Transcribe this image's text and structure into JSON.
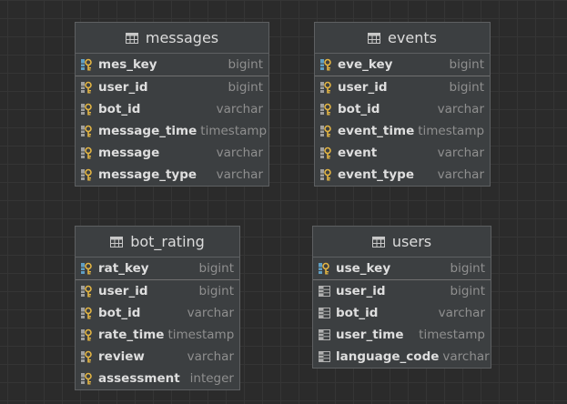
{
  "tables": [
    {
      "id": "messages",
      "title": "messages",
      "columns": [
        {
          "name": "mes_key",
          "type": "bigint",
          "icon": "primary-key-icon"
        },
        {
          "name": "user_id",
          "type": "bigint",
          "icon": "column-key-icon"
        },
        {
          "name": "bot_id",
          "type": "varchar",
          "icon": "column-key-icon"
        },
        {
          "name": "message_time",
          "type": "timestamp",
          "icon": "column-key-icon"
        },
        {
          "name": "message",
          "type": "varchar",
          "icon": "column-key-icon"
        },
        {
          "name": "message_type",
          "type": "varchar",
          "icon": "column-key-icon"
        }
      ]
    },
    {
      "id": "events",
      "title": "events",
      "columns": [
        {
          "name": "eve_key",
          "type": "bigint",
          "icon": "primary-key-icon"
        },
        {
          "name": "user_id",
          "type": "bigint",
          "icon": "column-key-icon"
        },
        {
          "name": "bot_id",
          "type": "varchar",
          "icon": "column-key-icon"
        },
        {
          "name": "event_time",
          "type": "timestamp",
          "icon": "column-key-icon"
        },
        {
          "name": "event",
          "type": "varchar",
          "icon": "column-key-icon"
        },
        {
          "name": "event_type",
          "type": "varchar",
          "icon": "column-key-icon"
        }
      ]
    },
    {
      "id": "bot-rating",
      "title": "bot_rating",
      "columns": [
        {
          "name": "rat_key",
          "type": "bigint",
          "icon": "primary-key-icon"
        },
        {
          "name": "user_id",
          "type": "bigint",
          "icon": "column-key-icon"
        },
        {
          "name": "bot_id",
          "type": "varchar",
          "icon": "column-key-icon"
        },
        {
          "name": "rate_time",
          "type": "timestamp",
          "icon": "column-key-icon"
        },
        {
          "name": "review",
          "type": "varchar",
          "icon": "column-key-icon"
        },
        {
          "name": "assessment",
          "type": "integer",
          "icon": "column-key-icon"
        }
      ]
    },
    {
      "id": "users",
      "title": "users",
      "columns": [
        {
          "name": "use_key",
          "type": "bigint",
          "icon": "primary-key-icon"
        },
        {
          "name": "user_id",
          "type": "bigint",
          "icon": "column-icon"
        },
        {
          "name": "bot_id",
          "type": "varchar",
          "icon": "column-icon"
        },
        {
          "name": "user_time",
          "type": "timestamp",
          "icon": "column-icon"
        },
        {
          "name": "language_code",
          "type": "varchar",
          "icon": "column-icon"
        }
      ]
    }
  ]
}
